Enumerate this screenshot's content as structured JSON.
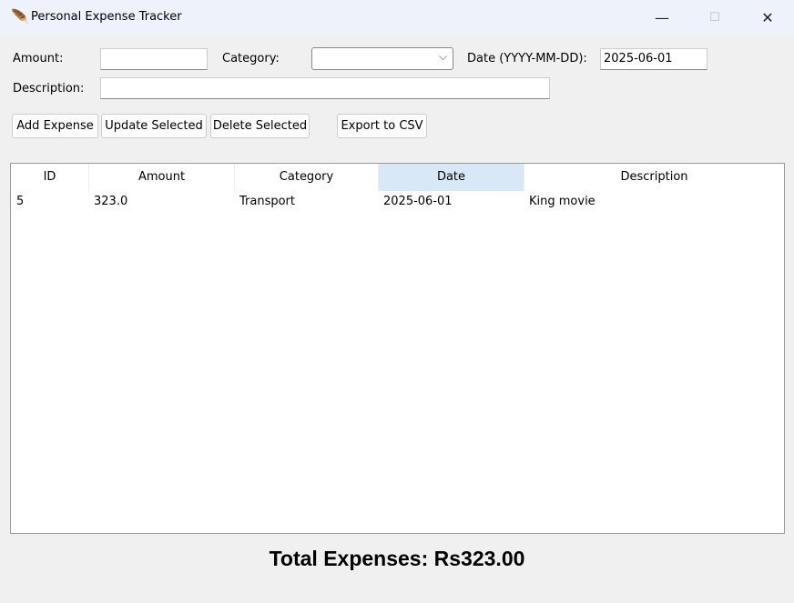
{
  "window": {
    "title": "Personal Expense Tracker",
    "minimize": "—",
    "maximize": "☐",
    "close": "✕"
  },
  "form": {
    "amount_label": "Amount:",
    "amount_value": "",
    "category_label": "Category:",
    "category_value": "",
    "date_label": "Date (YYYY-MM-DD):",
    "date_value": "2025-06-01",
    "description_label": "Description:",
    "description_value": ""
  },
  "buttons": {
    "add": "Add Expense",
    "update": "Update Selected",
    "delete": "Delete Selected",
    "export": "Export to CSV"
  },
  "table": {
    "columns": [
      "ID",
      "Amount",
      "Category",
      "Date",
      "Description"
    ],
    "sorted_column": "Date",
    "rows": [
      [
        "5",
        "323.0",
        "Transport",
        "2025-06-01",
        "King movie"
      ]
    ]
  },
  "total": "Total Expenses: Rs323.00",
  "colors": {
    "titlebar": "#eef2fa",
    "header_highlight": "#d9e8f6"
  }
}
